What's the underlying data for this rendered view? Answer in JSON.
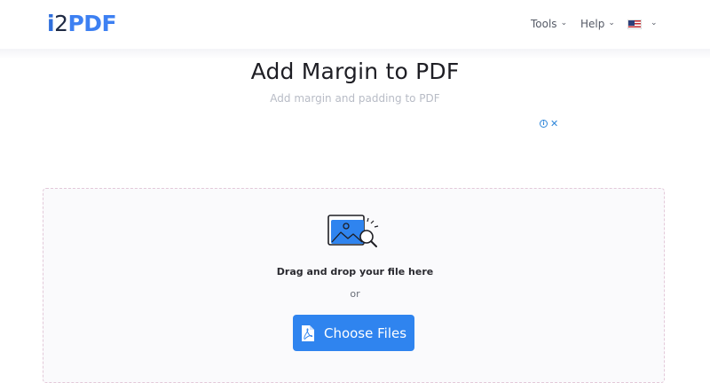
{
  "header": {
    "logo": {
      "part1": "i",
      "part2": "2",
      "part3": "PDF"
    },
    "nav": {
      "tools_label": "Tools",
      "help_label": "Help",
      "language_icon": "us-flag-icon"
    }
  },
  "main": {
    "title": "Add Margin to PDF",
    "subtitle": "Add margin and padding to PDF"
  },
  "ad": {
    "info_icon": "info-icon",
    "close_icon": "close-icon",
    "info_glyph": "i",
    "close_glyph": "✕"
  },
  "upload": {
    "illustration_icon": "image-search-icon",
    "drag_text": "Drag and drop your file here",
    "or_text": "or",
    "button_label": "Choose Files",
    "button_icon": "pdf-file-icon"
  },
  "colors": {
    "accent": "#2f84ef",
    "logo_blue": "#3d80f2",
    "logo_dark": "#1f2a44",
    "dropzone_border": "#e3c9d9"
  }
}
